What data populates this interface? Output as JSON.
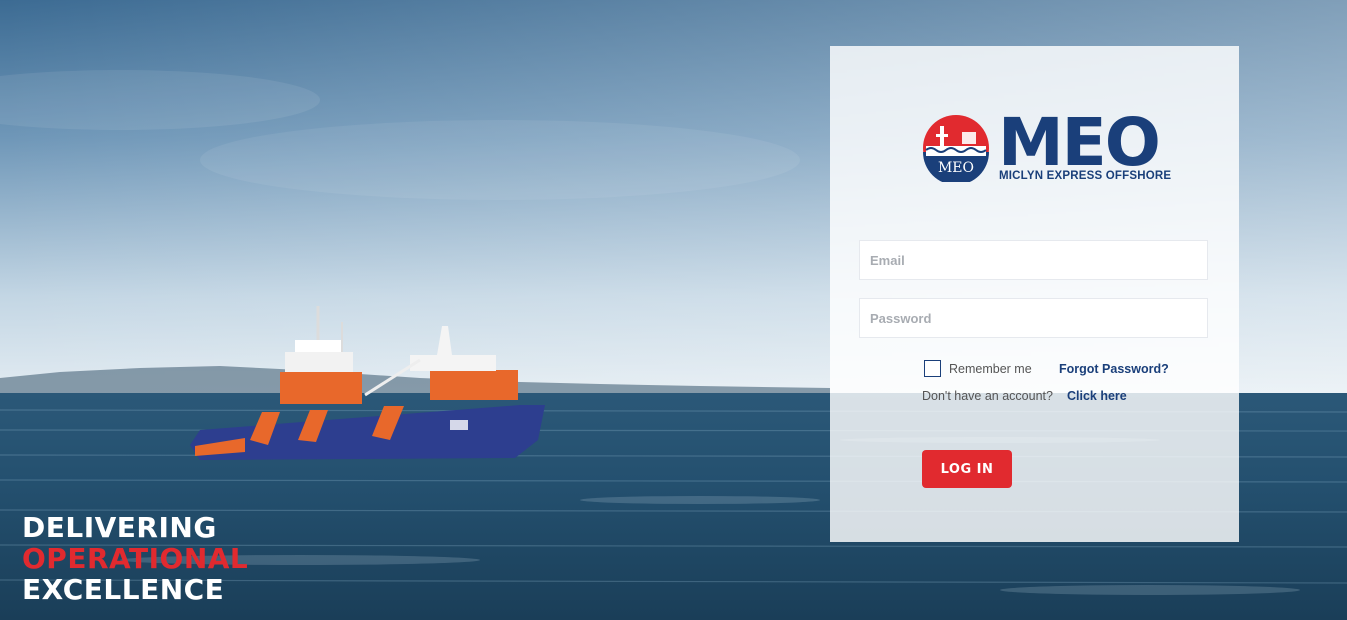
{
  "tagline": {
    "line1": "DELIVERING",
    "line2": "OPERATIONAL",
    "line3": "EXCELLENCE"
  },
  "logo": {
    "badge_text": "MEO",
    "brand": "MEO",
    "subtitle": "MICLYN EXPRESS OFFSHORE"
  },
  "form": {
    "email_placeholder": "Email",
    "email_value": "",
    "password_placeholder": "Password",
    "password_value": "",
    "remember_label": "Remember me",
    "remember_checked": false,
    "forgot_label": "Forgot Password?",
    "no_account_text": "Don't have an account?",
    "click_here_label": "Click here",
    "login_label": "LOG IN"
  },
  "colors": {
    "brand_navy": "#1a3f7a",
    "accent_red": "#e12a2f",
    "panel_bg": "rgba(255,255,255,0.82)"
  }
}
